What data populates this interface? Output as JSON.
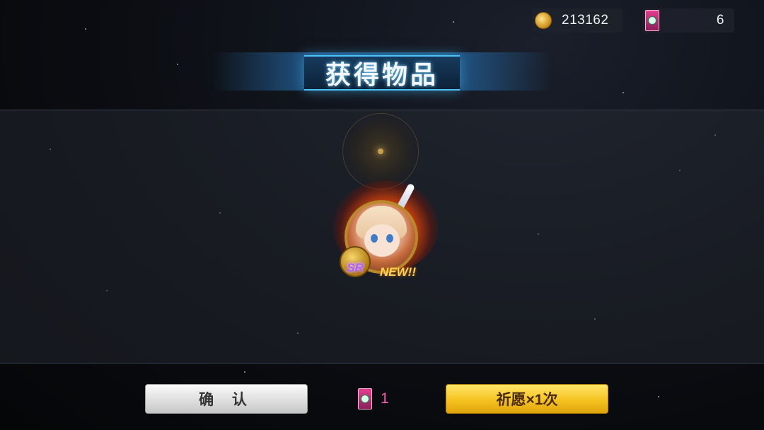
{
  "top_bar": {
    "coins": "213162",
    "tickets": "6"
  },
  "title": "获得物品",
  "reward": {
    "rarity": "SR",
    "new_tag": "NEW!!"
  },
  "footer": {
    "confirm_label": "确 认",
    "wish_cost": "1",
    "wish_label": "祈愿×1次"
  },
  "colors": {
    "accent_blue": "#4cc3ff",
    "gold_button": "#f5c320",
    "ticket_pink": "#e43e8e",
    "cost_pink": "#ff5aa8"
  },
  "icons": [
    "coin-icon",
    "wish-ticket-icon"
  ]
}
